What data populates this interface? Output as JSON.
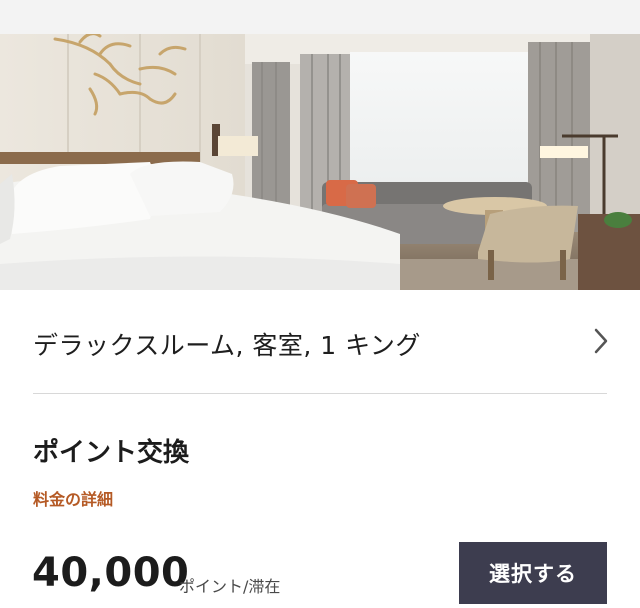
{
  "room": {
    "photo_icon": "hotel-room-photo",
    "title": "デラックスルーム, 客室, 1 キング",
    "chevron_icon": "chevron-right-icon"
  },
  "redemption": {
    "title": "ポイント交換",
    "rate_details_link": "料金の詳細",
    "points": "40,000",
    "unit": "ポイント/滞在",
    "select_button": "選択する"
  },
  "colors": {
    "accent_link": "#b55a25",
    "button_bg": "#3d3d4f",
    "button_text": "#ffffff"
  }
}
